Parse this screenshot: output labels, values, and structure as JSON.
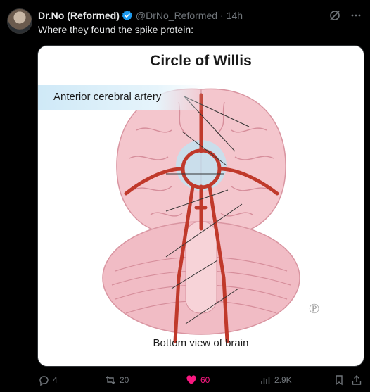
{
  "tweet": {
    "author_name": "Dr.No (Reformed)",
    "handle": "@DrNo_Reformed",
    "separator": "·",
    "time": "14h",
    "text": "Where they found the spike protein:"
  },
  "media": {
    "title": "Circle of Willis",
    "label_anterior": "Anterior cerebral artery",
    "caption": "Bottom view of brain"
  },
  "actions": {
    "replies": "4",
    "retweets": "20",
    "likes": "60",
    "views": "2.9K"
  },
  "colors": {
    "like": "#f91880",
    "muted": "#71767b",
    "verified": "#1d9bf0",
    "brain": "#f3c4cc",
    "artery": "#c0392b"
  }
}
